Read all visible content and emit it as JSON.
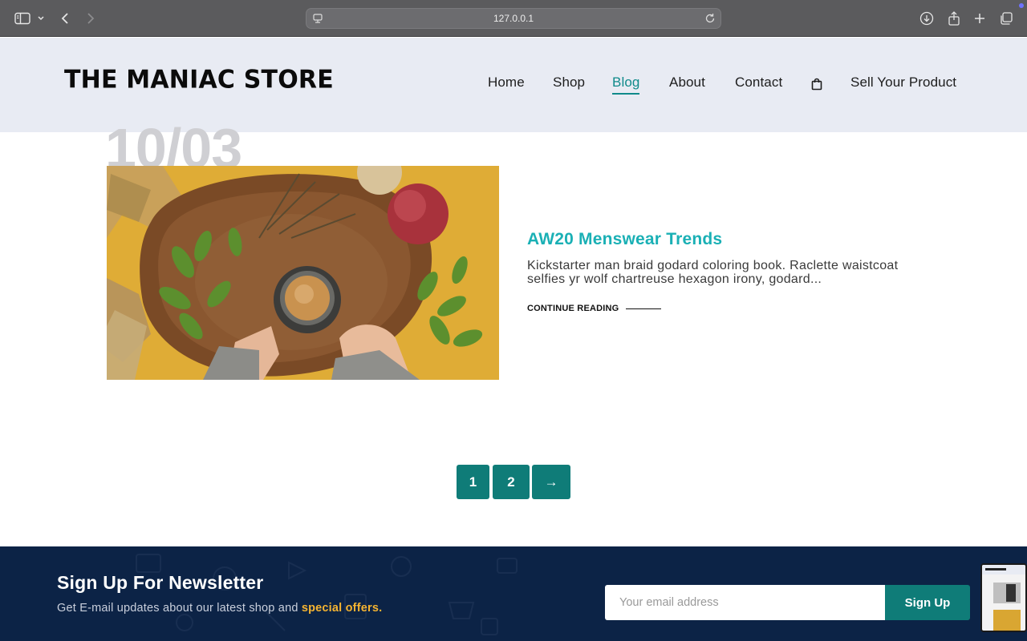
{
  "browser": {
    "url": "127.0.0.1"
  },
  "site": {
    "logo": "THE MANIAC STORE",
    "nav": [
      {
        "label": "Home"
      },
      {
        "label": "Shop"
      },
      {
        "label": "Blog",
        "active": true
      },
      {
        "label": "About"
      },
      {
        "label": "Contact"
      },
      {
        "label": "Sell Your Product"
      }
    ],
    "accent_color": "#0f8a8a"
  },
  "post": {
    "date": "10/03",
    "title": "AW20 Menswear Trends",
    "excerpt": "Kickstarter man braid godard coloring book. Raclette waistcoat selfies yr wolf chartreuse hexagon irony, godard...",
    "continue_label": "CONTINUE READING"
  },
  "pagination": {
    "pages": [
      "1",
      "2"
    ],
    "next_label": "→"
  },
  "newsletter": {
    "title": "Sign Up For Newsletter",
    "subtitle_start": "Get E-mail updates about our latest shop and ",
    "subtitle_highlight": "special offers.",
    "email_placeholder": "Your email address",
    "button_label": "Sign Up"
  }
}
